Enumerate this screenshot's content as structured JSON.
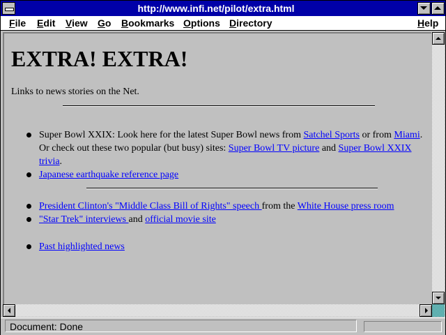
{
  "window": {
    "title": "http://www.infi.net/pilot/extra.html"
  },
  "menu": {
    "file": {
      "key": "F",
      "rest": "ile"
    },
    "edit": {
      "key": "E",
      "rest": "dit"
    },
    "view": {
      "key": "V",
      "rest": "iew"
    },
    "go": {
      "key": "G",
      "rest": "o"
    },
    "bookmarks": {
      "key": "B",
      "rest": "ookmarks"
    },
    "options": {
      "key": "O",
      "rest": "ptions"
    },
    "directory": {
      "key": "D",
      "rest": "irectory"
    },
    "help": {
      "key": "H",
      "rest": "elp"
    }
  },
  "page": {
    "heading": "EXTRA! EXTRA!",
    "intro": "Links to news stories on the Net.",
    "item1": {
      "text_a": "Super Bowl XXIX: Look here for the latest Super Bowl news from ",
      "link_satchel": "Satchel Sports",
      "text_b": " or from ",
      "link_miami": "Miami",
      "text_c": ". Or check out these two popular (but busy) sites: ",
      "link_tv": "Super Bowl TV picture",
      "text_d": " and ",
      "link_trivia": "Super Bowl XXIX trivia",
      "text_e": "."
    },
    "item2": {
      "link": "Japanese earthquake reference page"
    },
    "item3": {
      "link_speech": "President Clinton's \"Middle Class Bill of Rights\" speech ",
      "text_a": "from the ",
      "link_whitehouse": "White House press room"
    },
    "item4": {
      "link_startrek": "\"Star Trek\" interviews ",
      "text_a": "and ",
      "link_movie": "official movie site"
    },
    "item5": {
      "link": "Past highlighted news "
    }
  },
  "status": {
    "text": "Document: Done"
  }
}
